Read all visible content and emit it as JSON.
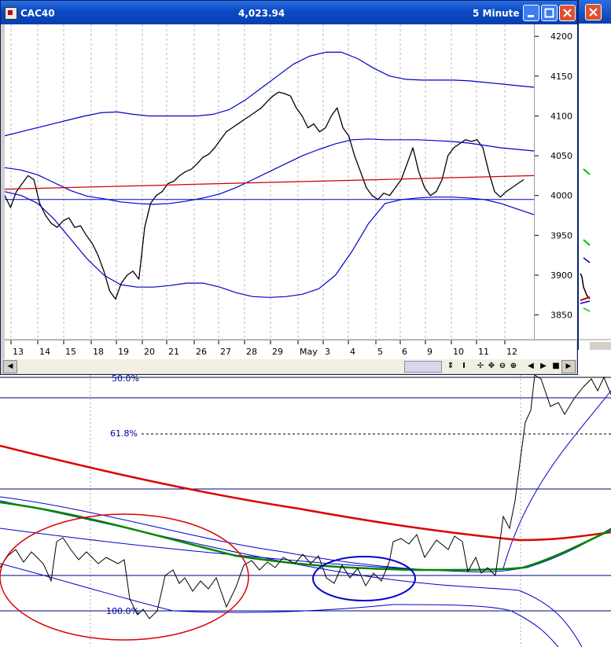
{
  "window": {
    "title": "CAC40",
    "price": "4,023.94",
    "interval": "5 Minute",
    "buttons": [
      "minimize-icon",
      "maximize-icon",
      "close-icon"
    ]
  },
  "chart_data": [
    {
      "type": "line",
      "title": "",
      "instrument": "CAC40",
      "yticks": [
        4200,
        4150,
        4100,
        4050,
        4000,
        3950,
        3900,
        3850
      ],
      "ylim": [
        3820,
        4215
      ],
      "xticks": [
        "13",
        "14",
        "15",
        "18",
        "19",
        "20",
        "21",
        "26",
        "27",
        "28",
        "29",
        "May",
        "3",
        "4",
        "5",
        "6",
        "9",
        "10",
        "11",
        "12"
      ],
      "grid": true,
      "series": [
        {
          "role": "price",
          "color": "#000000",
          "values": [
            4000,
            3985,
            4005,
            4015,
            4025,
            4020,
            3990,
            3975,
            3965,
            3960,
            3968,
            3972,
            3960,
            3962,
            3950,
            3940,
            3925,
            3905,
            3880,
            3870,
            3890,
            3900,
            3905,
            3895,
            3960,
            3990,
            4000,
            4005,
            4015,
            4018,
            4025,
            4030,
            4033,
            4040,
            4048,
            4052,
            4060,
            4070,
            4080,
            4085,
            4090,
            4095,
            4100,
            4105,
            4110,
            4118,
            4125,
            4130,
            4128,
            4125,
            4110,
            4100,
            4085,
            4090,
            4080,
            4085,
            4100,
            4110,
            4085,
            4075,
            4050,
            4030,
            4010,
            4000,
            3995,
            4003,
            4000,
            4010,
            4020,
            4040,
            4060,
            4030,
            4010,
            4000,
            4005,
            4020,
            4050,
            4060,
            4065,
            4070,
            4068,
            4070,
            4060,
            4030,
            4005,
            3998,
            4005,
            4010,
            4015,
            4020
          ]
        },
        {
          "role": "upper-band",
          "color": "#0000cc",
          "values": [
            4075,
            4080,
            4085,
            4090,
            4095,
            4100,
            4104,
            4105,
            4102,
            4100,
            4100,
            4100,
            4100,
            4102,
            4108,
            4120,
            4135,
            4150,
            4165,
            4175,
            4180,
            4180,
            4172,
            4160,
            4150,
            4146,
            4145,
            4145,
            4145,
            4144,
            4142,
            4140,
            4138,
            4136
          ]
        },
        {
          "role": "middle-band",
          "color": "#0000cc",
          "values": [
            4035,
            4032,
            4026,
            4016,
            4006,
            3999,
            3996,
            3992,
            3990,
            3989,
            3990,
            3993,
            3997,
            4002,
            4010,
            4020,
            4030,
            4040,
            4050,
            4058,
            4065,
            4070,
            4071,
            4070,
            4070,
            4070,
            4069,
            4068,
            4066,
            4063,
            4060,
            4058,
            4056
          ]
        },
        {
          "role": "lower-band",
          "color": "#0000cc",
          "values": [
            4005,
            4000,
            3990,
            3970,
            3945,
            3920,
            3900,
            3888,
            3885,
            3885,
            3887,
            3890,
            3890,
            3885,
            3878,
            3873,
            3872,
            3873,
            3876,
            3883,
            3900,
            3930,
            3965,
            3990,
            3995,
            3997,
            3998,
            3998,
            3997,
            3995,
            3990,
            3983,
            3976
          ]
        },
        {
          "role": "moving-average",
          "color": "#cc0000",
          "values": [
            4008,
            4009,
            4010,
            4011,
            4012,
            4013,
            4014,
            4015,
            4016,
            4017,
            4018,
            4019,
            4020,
            4021,
            4022,
            4023,
            4024,
            4025
          ]
        },
        {
          "role": "horizontal-line",
          "color": "#0000cc",
          "values": [
            3995
          ]
        }
      ]
    },
    {
      "type": "line",
      "title": "",
      "fibonacci_levels": [
        "50.0%",
        "61.8%",
        "100.0%"
      ],
      "series": [
        {
          "role": "price",
          "color": "#000000"
        },
        {
          "role": "band",
          "color": "#0000cc"
        },
        {
          "role": "moving-average-red",
          "color": "#dd0000"
        },
        {
          "role": "moving-average-green",
          "color": "#008800"
        }
      ],
      "annotations": [
        {
          "shape": "ellipse",
          "color": "#dd0000"
        },
        {
          "shape": "ellipse",
          "color": "#0000cc"
        }
      ]
    }
  ],
  "toolbar_icons": [
    "scroll-icon",
    "cursor-icon",
    "crosshair-icon",
    "move-icon",
    "zoom-out-icon",
    "zoom-in-icon",
    "prev-icon",
    "next-icon",
    "stop-icon"
  ]
}
